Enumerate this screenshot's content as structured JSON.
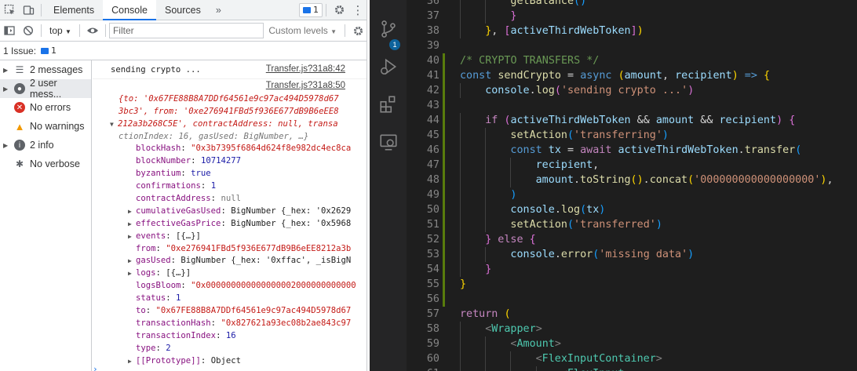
{
  "devtools": {
    "tabs": [
      "Elements",
      "Console",
      "Sources"
    ],
    "tabs_more": "»",
    "active_tab": "Console",
    "issues_badge_count": "1",
    "context_selector": "top",
    "filter_placeholder": "Filter",
    "levels_selector": "Custom levels",
    "issues_label": "1 Issue:",
    "issues_count": "1",
    "sidebar": [
      {
        "icon": "list-icon",
        "label": "2 messages"
      },
      {
        "icon": "user-icon",
        "label": "2 user mess..."
      },
      {
        "icon": "error-icon",
        "label": "No errors"
      },
      {
        "icon": "warning-icon",
        "label": "No warnings"
      },
      {
        "icon": "info-icon",
        "label": "2 info"
      },
      {
        "icon": "bug-icon",
        "label": "No verbose"
      }
    ],
    "log": {
      "msg1": {
        "text": "sending crypto ...",
        "source": "Transfer.js?31a8:42"
      },
      "msg2": {
        "source": "Transfer.js?31a8:50",
        "summary_1": "{to: '0x67FE88B8A7DDf64561e9c97ac494D5978d67",
        "summary_2": "3bc3', from: '0xe276941FBd5f936E677dB9B6eEE8",
        "summary_3": "212a3b268C5E', contractAddress: null, transa",
        "summary_4": "ctionIndex: 16, gasUsed: BigNumber, …}",
        "props": [
          {
            "k": "blockHash",
            "v": "\"0x3b7395f6864d624f8e982dc4ec8ca",
            "kind": "s",
            "expand": false
          },
          {
            "k": "blockNumber",
            "v": "10714277",
            "kind": "b",
            "expand": false
          },
          {
            "k": "byzantium",
            "v": "true",
            "kind": "b",
            "expand": false
          },
          {
            "k": "confirmations",
            "v": "1",
            "kind": "b",
            "expand": false
          },
          {
            "k": "contractAddress",
            "v": "null",
            "kind": "g",
            "expand": false
          },
          {
            "k": "cumulativeGasUsed",
            "v": "BigNumber {_hex: '0x2629",
            "kind": "p",
            "expand": true
          },
          {
            "k": "effectiveGasPrice",
            "v": "BigNumber {_hex: '0x5968",
            "kind": "p",
            "expand": true
          },
          {
            "k": "events",
            "v": "[{…}]",
            "kind": "p",
            "expand": true
          },
          {
            "k": "from",
            "v": "\"0xe276941FBd5f936E677dB9B6eEE8212a3b",
            "kind": "s",
            "expand": false
          },
          {
            "k": "gasUsed",
            "v": "BigNumber {_hex: '0xffac', _isBigN",
            "kind": "p",
            "expand": true
          },
          {
            "k": "logs",
            "v": "[{…}]",
            "kind": "p",
            "expand": true
          },
          {
            "k": "logsBloom",
            "v": "\"0x000000000000000002000000000000",
            "kind": "s",
            "expand": false
          },
          {
            "k": "status",
            "v": "1",
            "kind": "b",
            "expand": false
          },
          {
            "k": "to",
            "v": "\"0x67FE88B8A7DDf64561e9c97ac494D5978d67",
            "kind": "s",
            "expand": false
          },
          {
            "k": "transactionHash",
            "v": "\"0x827621a93ec08b2ae843c97",
            "kind": "s",
            "expand": false
          },
          {
            "k": "transactionIndex",
            "v": "16",
            "kind": "b",
            "expand": false
          },
          {
            "k": "type",
            "v": "2",
            "kind": "b",
            "expand": false
          },
          {
            "k": "[[Prototype]]",
            "v": "Object",
            "kind": "p",
            "expand": true
          }
        ]
      }
    }
  },
  "vscode": {
    "scm_badge": "1",
    "lines": [
      {
        "n": "36",
        "ind": 2,
        "mod": false,
        "t": [
          [
            "t-fn",
            "getBalance"
          ],
          [
            "t-br3",
            "()"
          ]
        ]
      },
      {
        "n": "37",
        "ind": 2,
        "mod": false,
        "t": [
          [
            "t-br2",
            "}"
          ]
        ]
      },
      {
        "n": "38",
        "ind": 1,
        "mod": false,
        "t": [
          [
            "t-br1",
            "}"
          ],
          [
            "t-pl",
            ", "
          ],
          [
            "t-br2",
            "["
          ],
          [
            "t-var",
            "activeThirdWebToken"
          ],
          [
            "t-br2",
            "]"
          ],
          [
            "t-br1",
            ")"
          ]
        ]
      },
      {
        "n": "39",
        "ind": 0,
        "mod": false,
        "t": []
      },
      {
        "n": "40",
        "ind": 0,
        "mod": true,
        "t": [
          [
            "t-cm",
            "/* CRYPTO TRANSFERS */"
          ]
        ]
      },
      {
        "n": "41",
        "ind": 0,
        "mod": true,
        "t": [
          [
            "t-kw",
            "const "
          ],
          [
            "t-fn",
            "sendCrypto"
          ],
          [
            "t-pl",
            " = "
          ],
          [
            "t-kw",
            "async "
          ],
          [
            "t-br1",
            "("
          ],
          [
            "t-var",
            "amount"
          ],
          [
            "t-pl",
            ", "
          ],
          [
            "t-var",
            "recipient"
          ],
          [
            "t-br1",
            ")"
          ],
          [
            "t-kw",
            " => "
          ],
          [
            "t-br1",
            "{"
          ]
        ]
      },
      {
        "n": "42",
        "ind": 1,
        "mod": true,
        "t": [
          [
            "t-var",
            "console"
          ],
          [
            "t-pl",
            "."
          ],
          [
            "t-fn",
            "log"
          ],
          [
            "t-br2",
            "("
          ],
          [
            "t-str",
            "'sending crypto ...'"
          ],
          [
            "t-br2",
            ")"
          ]
        ]
      },
      {
        "n": "43",
        "ind": 0,
        "mod": true,
        "t": []
      },
      {
        "n": "44",
        "ind": 1,
        "mod": true,
        "t": [
          [
            "t-ctrl",
            "if "
          ],
          [
            "t-br2",
            "("
          ],
          [
            "t-var",
            "activeThirdWebToken"
          ],
          [
            "t-pl",
            " && "
          ],
          [
            "t-var",
            "amount"
          ],
          [
            "t-pl",
            " && "
          ],
          [
            "t-var",
            "recipient"
          ],
          [
            "t-br2",
            ")"
          ],
          [
            "t-pl",
            " "
          ],
          [
            "t-br2",
            "{"
          ]
        ]
      },
      {
        "n": "45",
        "ind": 2,
        "mod": true,
        "t": [
          [
            "t-fn",
            "setAction"
          ],
          [
            "t-br3",
            "("
          ],
          [
            "t-str",
            "'transferring'"
          ],
          [
            "t-br3",
            ")"
          ]
        ]
      },
      {
        "n": "46",
        "ind": 2,
        "mod": true,
        "t": [
          [
            "t-kw",
            "const "
          ],
          [
            "t-var",
            "tx"
          ],
          [
            "t-pl",
            " = "
          ],
          [
            "t-ctrl",
            "await "
          ],
          [
            "t-var",
            "activeThirdWebToken"
          ],
          [
            "t-pl",
            "."
          ],
          [
            "t-fn",
            "transfer"
          ],
          [
            "t-br3",
            "("
          ]
        ]
      },
      {
        "n": "47",
        "ind": 3,
        "mod": true,
        "t": [
          [
            "t-var",
            "recipient"
          ],
          [
            "t-pl",
            ","
          ]
        ]
      },
      {
        "n": "48",
        "ind": 3,
        "mod": true,
        "t": [
          [
            "t-var",
            "amount"
          ],
          [
            "t-pl",
            "."
          ],
          [
            "t-fn",
            "toString"
          ],
          [
            "t-br1",
            "()"
          ],
          [
            "t-pl",
            "."
          ],
          [
            "t-fn",
            "concat"
          ],
          [
            "t-br1",
            "("
          ],
          [
            "t-str",
            "'000000000000000000'"
          ],
          [
            "t-br1",
            ")"
          ],
          [
            "t-pl",
            ","
          ]
        ]
      },
      {
        "n": "49",
        "ind": 2,
        "mod": true,
        "t": [
          [
            "t-br3",
            ")"
          ]
        ]
      },
      {
        "n": "50",
        "ind": 2,
        "mod": true,
        "t": [
          [
            "t-var",
            "console"
          ],
          [
            "t-pl",
            "."
          ],
          [
            "t-fn",
            "log"
          ],
          [
            "t-br3",
            "("
          ],
          [
            "t-var",
            "tx"
          ],
          [
            "t-br3",
            ")"
          ]
        ]
      },
      {
        "n": "51",
        "ind": 2,
        "mod": true,
        "t": [
          [
            "t-fn",
            "setAction"
          ],
          [
            "t-br3",
            "("
          ],
          [
            "t-str",
            "'transferred'"
          ],
          [
            "t-br3",
            ")"
          ]
        ]
      },
      {
        "n": "52",
        "ind": 1,
        "mod": true,
        "t": [
          [
            "t-br2",
            "}"
          ],
          [
            "t-ctrl",
            " else "
          ],
          [
            "t-br2",
            "{"
          ]
        ]
      },
      {
        "n": "53",
        "ind": 2,
        "mod": true,
        "t": [
          [
            "t-var",
            "console"
          ],
          [
            "t-pl",
            "."
          ],
          [
            "t-fn",
            "error"
          ],
          [
            "t-br3",
            "("
          ],
          [
            "t-str",
            "'missing data'"
          ],
          [
            "t-br3",
            ")"
          ]
        ]
      },
      {
        "n": "54",
        "ind": 1,
        "mod": true,
        "t": [
          [
            "t-br2",
            "}"
          ]
        ]
      },
      {
        "n": "55",
        "ind": 0,
        "mod": true,
        "t": [
          [
            "t-br1",
            "}"
          ]
        ]
      },
      {
        "n": "56",
        "ind": 0,
        "mod": true,
        "t": []
      },
      {
        "n": "57",
        "ind": 0,
        "mod": false,
        "t": [
          [
            "t-ctrl",
            "return "
          ],
          [
            "t-br1",
            "("
          ]
        ]
      },
      {
        "n": "58",
        "ind": 1,
        "mod": false,
        "t": [
          [
            "t-tg",
            "<"
          ],
          [
            "t-tag",
            "Wrapper"
          ],
          [
            "t-tg",
            ">"
          ]
        ]
      },
      {
        "n": "59",
        "ind": 2,
        "mod": false,
        "t": [
          [
            "t-tg",
            "<"
          ],
          [
            "t-tag",
            "Amount"
          ],
          [
            "t-tg",
            ">"
          ]
        ]
      },
      {
        "n": "60",
        "ind": 3,
        "mod": false,
        "t": [
          [
            "t-tg",
            "<"
          ],
          [
            "t-tag",
            "FlexInputContainer"
          ],
          [
            "t-tg",
            ">"
          ]
        ]
      },
      {
        "n": "61",
        "ind": 4,
        "mod": false,
        "t": [
          [
            "t-tg",
            "<"
          ],
          [
            "t-tag",
            "FlexInput"
          ]
        ]
      }
    ]
  }
}
